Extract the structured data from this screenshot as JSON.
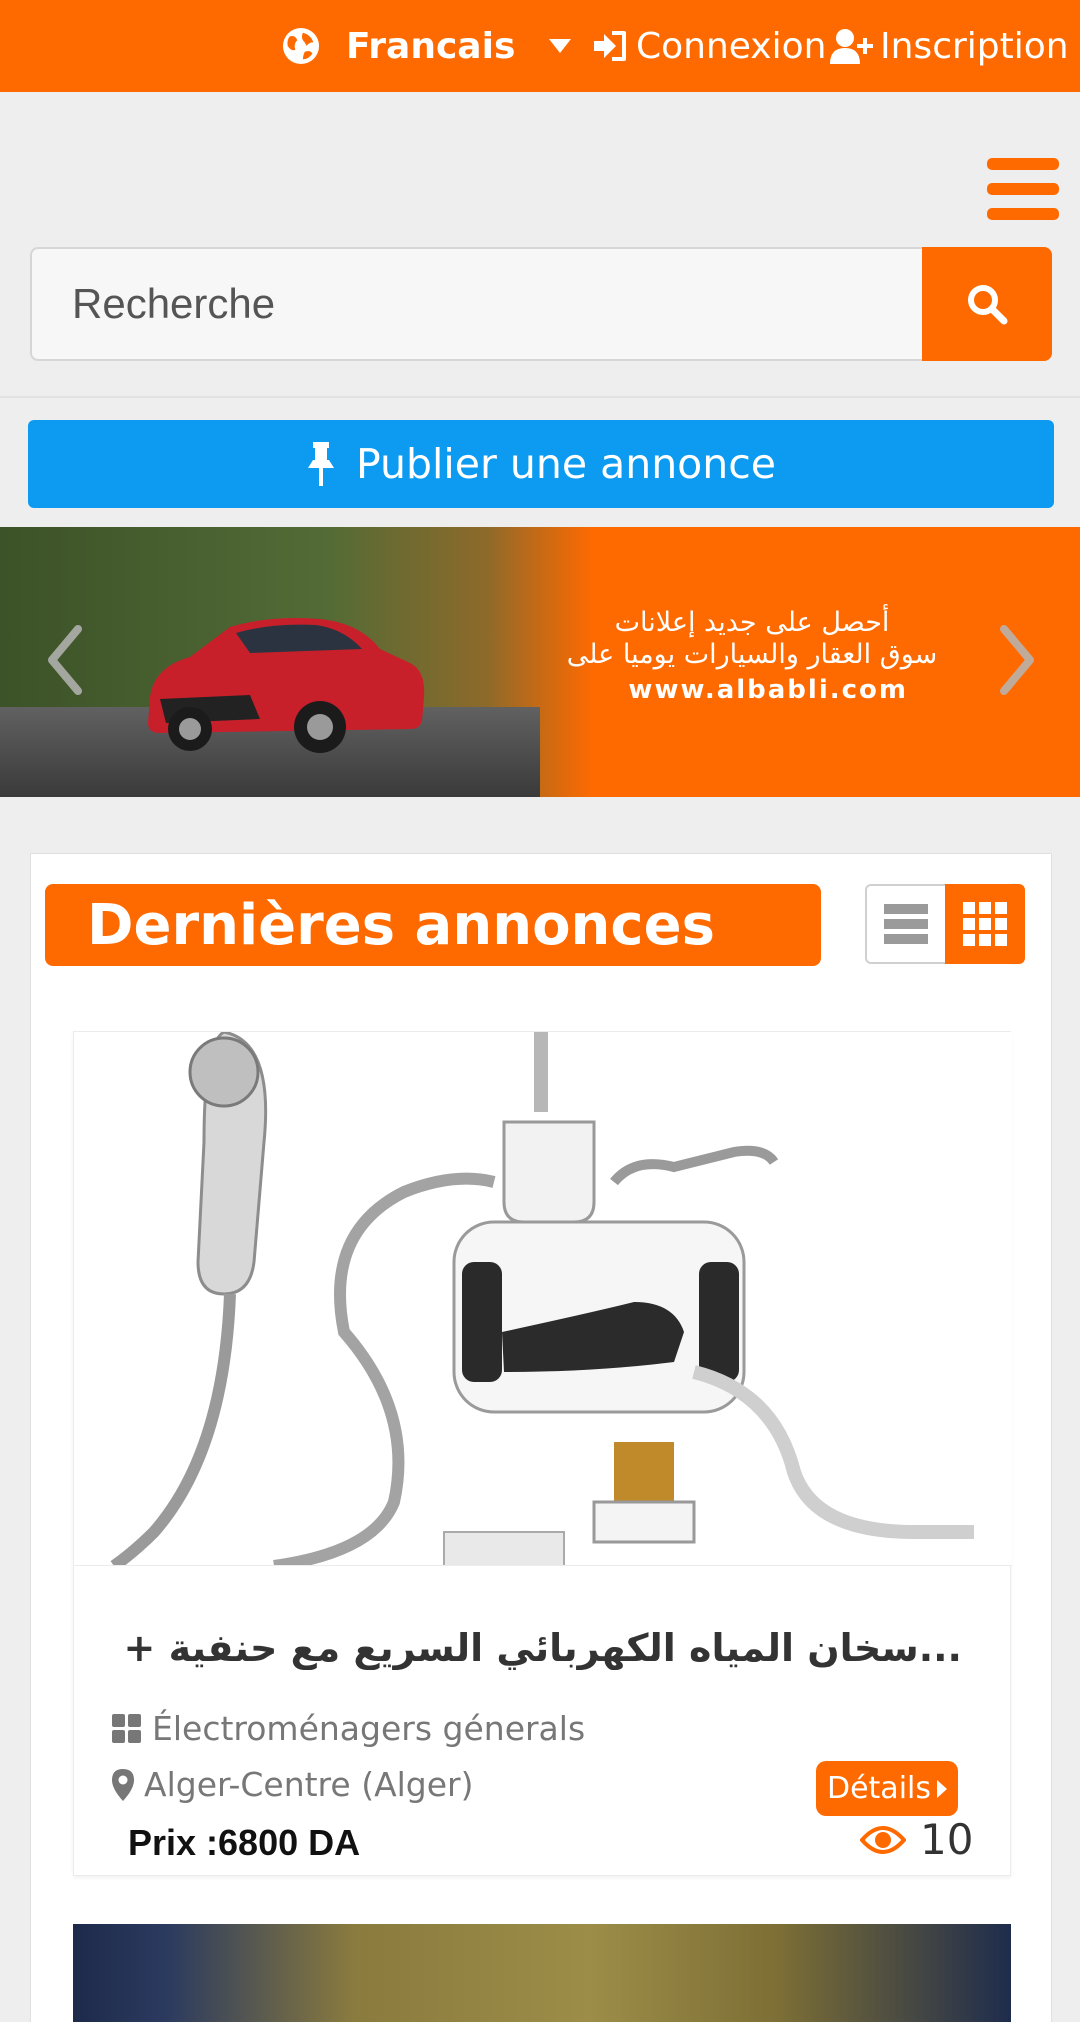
{
  "topbar": {
    "language": "Francais",
    "login": "Connexion",
    "signup": "Inscription"
  },
  "search": {
    "placeholder": "Recherche"
  },
  "publish": {
    "label": "Publier une annonce"
  },
  "banner": {
    "line1": "أحصل على جديد إعلانات",
    "line2": "سوق العقار والسيارات يوميا على",
    "url": "www.albabli.com"
  },
  "section": {
    "title": "Dernières annonces"
  },
  "listings": [
    {
      "title": "...سخان المياه الكهربائي السريع مع حنفية + مرش الدوش",
      "category": "Électroménagers génerals",
      "location": "Alger-Centre (Alger)",
      "price": "Prix :6800 DA",
      "details": "Détails",
      "views": "10"
    }
  ],
  "colors": {
    "brand": "#ff6a00",
    "publish": "#0d9bf2"
  },
  "icons": [
    "globe-icon",
    "caret-down-icon",
    "sign-in-icon",
    "user-plus-icon",
    "hamburger-icon",
    "search-icon",
    "pin-icon",
    "chevron-left-icon",
    "chevron-right-icon",
    "list-view-icon",
    "grid-view-icon",
    "category-icon",
    "map-marker-icon",
    "eye-icon"
  ]
}
